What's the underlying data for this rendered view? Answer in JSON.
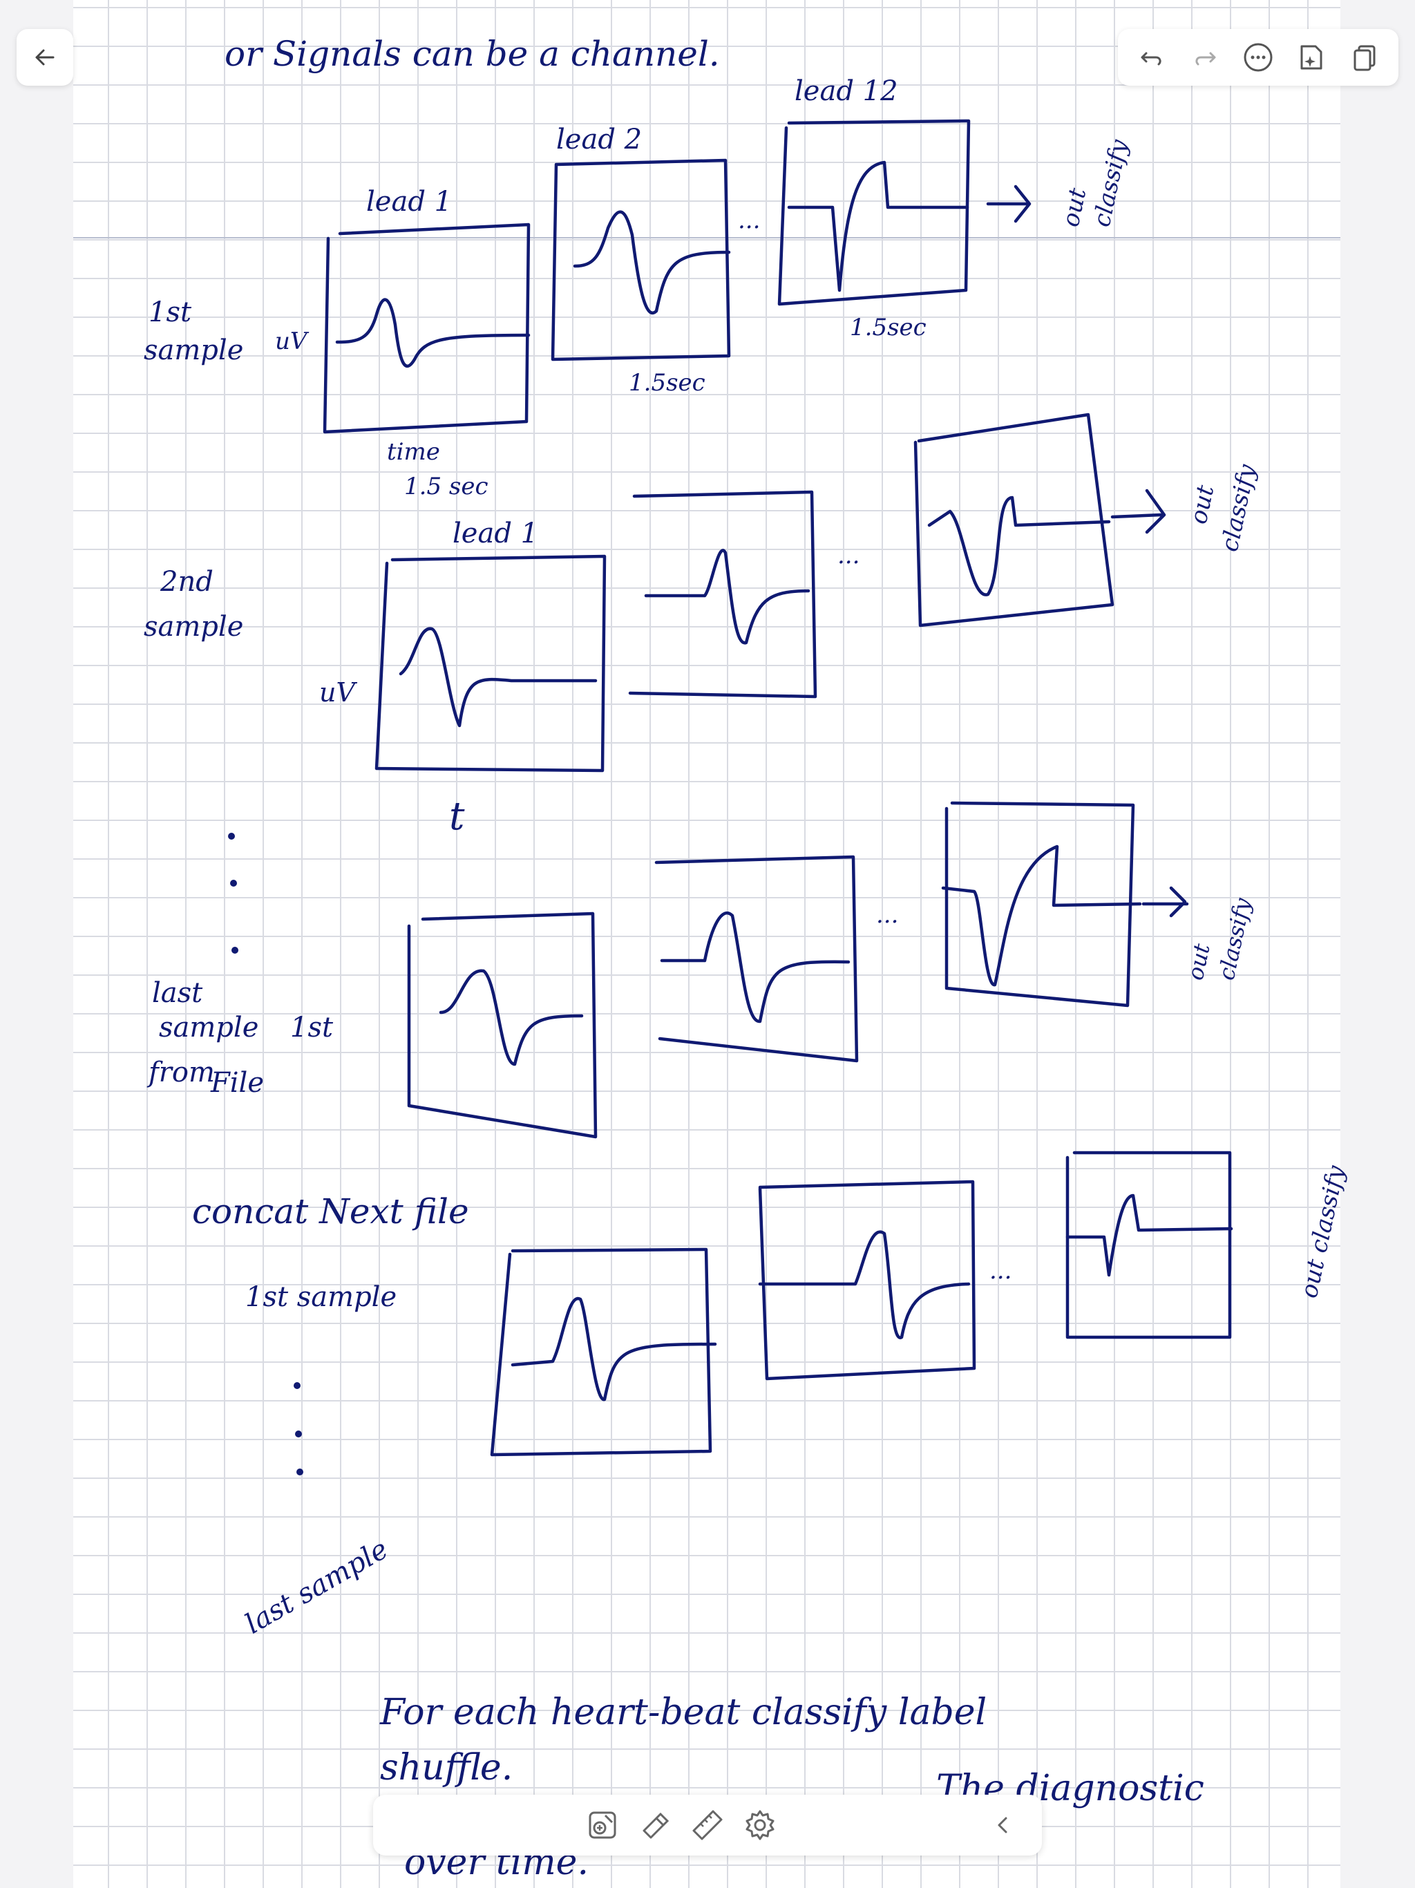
{
  "note": {
    "title_line": "or Signals can be a channel.",
    "leads": {
      "lead1": "lead 1",
      "lead2": "lead 2",
      "lead12": "lead 12"
    },
    "durations": {
      "d1": "1.5 sec",
      "d2": "1.5sec",
      "d3": "1.5sec"
    },
    "units": {
      "uv1": "uV",
      "uv2": "uV",
      "time": "time",
      "t": "t"
    },
    "samples": {
      "first": [
        "1st",
        "sample"
      ],
      "second": [
        "2nd",
        "sample"
      ],
      "last": [
        "last",
        "sample",
        "from",
        "File"
      ],
      "last_first": "1st"
    },
    "out_classify": {
      "row1": [
        "out",
        "classify"
      ],
      "row2": [
        "out",
        "classify"
      ],
      "row3": [
        "out",
        "classify"
      ],
      "row4": "out classify"
    },
    "lead1_row2": "lead 1",
    "ellipsis": "...",
    "concat": "concat Next file",
    "concat_sample": "1st sample",
    "last_sample_2": "last sample",
    "bottom_line1": "For each heart-beat classify label",
    "bottom_line2": "shuffle.",
    "bottom_line3": "The diagnostic",
    "bottom_line4": "over time."
  },
  "toolbar": {
    "back_icon": "arrow-left-icon",
    "undo_icon": "undo-icon",
    "redo_icon": "redo-icon",
    "more_icon": "more-icon",
    "ai_icon": "ai-sparkle-icon",
    "pages_icon": "pages-icon"
  },
  "bottom_tools": [
    "add-image-icon",
    "eraser-icon",
    "ruler-icon",
    "settings-gear-icon",
    "chevron-left-icon"
  ]
}
